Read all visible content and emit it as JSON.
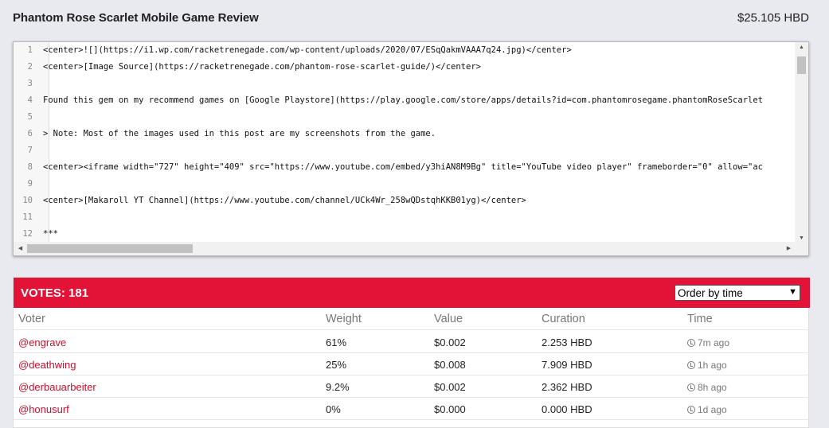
{
  "post": {
    "title": "Phantom Rose Scarlet Mobile Game Review",
    "value": "$25.105 HBD"
  },
  "editor": {
    "lines": [
      {
        "num": "1",
        "text": "<center>![](https://i1.wp.com/racketrenegade.com/wp-content/uploads/2020/07/ESqQakmVAAA7q24.jpg)</center>"
      },
      {
        "num": "2",
        "text": "<center>[Image Source](https://racketrenegade.com/phantom-rose-scarlet-guide/)</center>"
      },
      {
        "num": "3",
        "text": ""
      },
      {
        "num": "4",
        "text": "Found this gem on my recommend games on [Google Playstore](https://play.google.com/store/apps/details?id=com.phantomrosegame.phantomRoseScarlet"
      },
      {
        "num": "5",
        "text": ""
      },
      {
        "num": "6",
        "text": "> Note: Most of the images used in this post are my screenshots from the game."
      },
      {
        "num": "7",
        "text": ""
      },
      {
        "num": "8",
        "text": "<center><iframe width=\"727\" height=\"409\" src=\"https://www.youtube.com/embed/y3hiAN8M9Bg\" title=\"YouTube video player\" frameborder=\"0\" allow=\"ac"
      },
      {
        "num": "9",
        "text": ""
      },
      {
        "num": "10",
        "text": "<center>[Makaroll YT Channel](https://www.youtube.com/channel/UCk4Wr_258wQDstqhKKB01yg)</center>"
      },
      {
        "num": "11",
        "text": ""
      },
      {
        "num": "12",
        "text": "***"
      }
    ]
  },
  "votes": {
    "header": "VOTES: 181",
    "order_select": "Order by time",
    "columns": [
      "Voter",
      "Weight",
      "Value",
      "Curation",
      "Time"
    ],
    "rows": [
      {
        "voter": "@engrave",
        "weight": "61%",
        "value": "$0.002",
        "curation": "2.253 HBD",
        "time": "7m ago"
      },
      {
        "voter": "@deathwing",
        "weight": "25%",
        "value": "$0.008",
        "curation": "7.909 HBD",
        "time": "1h ago"
      },
      {
        "voter": "@derbauarbeiter",
        "weight": "9.2%",
        "value": "$0.002",
        "curation": "2.362 HBD",
        "time": "8h ago"
      },
      {
        "voter": "@honusurf",
        "weight": "0%",
        "value": "$0.000",
        "curation": "0.000 HBD",
        "time": "1d ago"
      }
    ]
  },
  "colors": {
    "accent": "#e31337",
    "voter_link": "#c8102e"
  },
  "icons": {
    "time": "clock-icon",
    "select": "chevron-down-icon"
  }
}
